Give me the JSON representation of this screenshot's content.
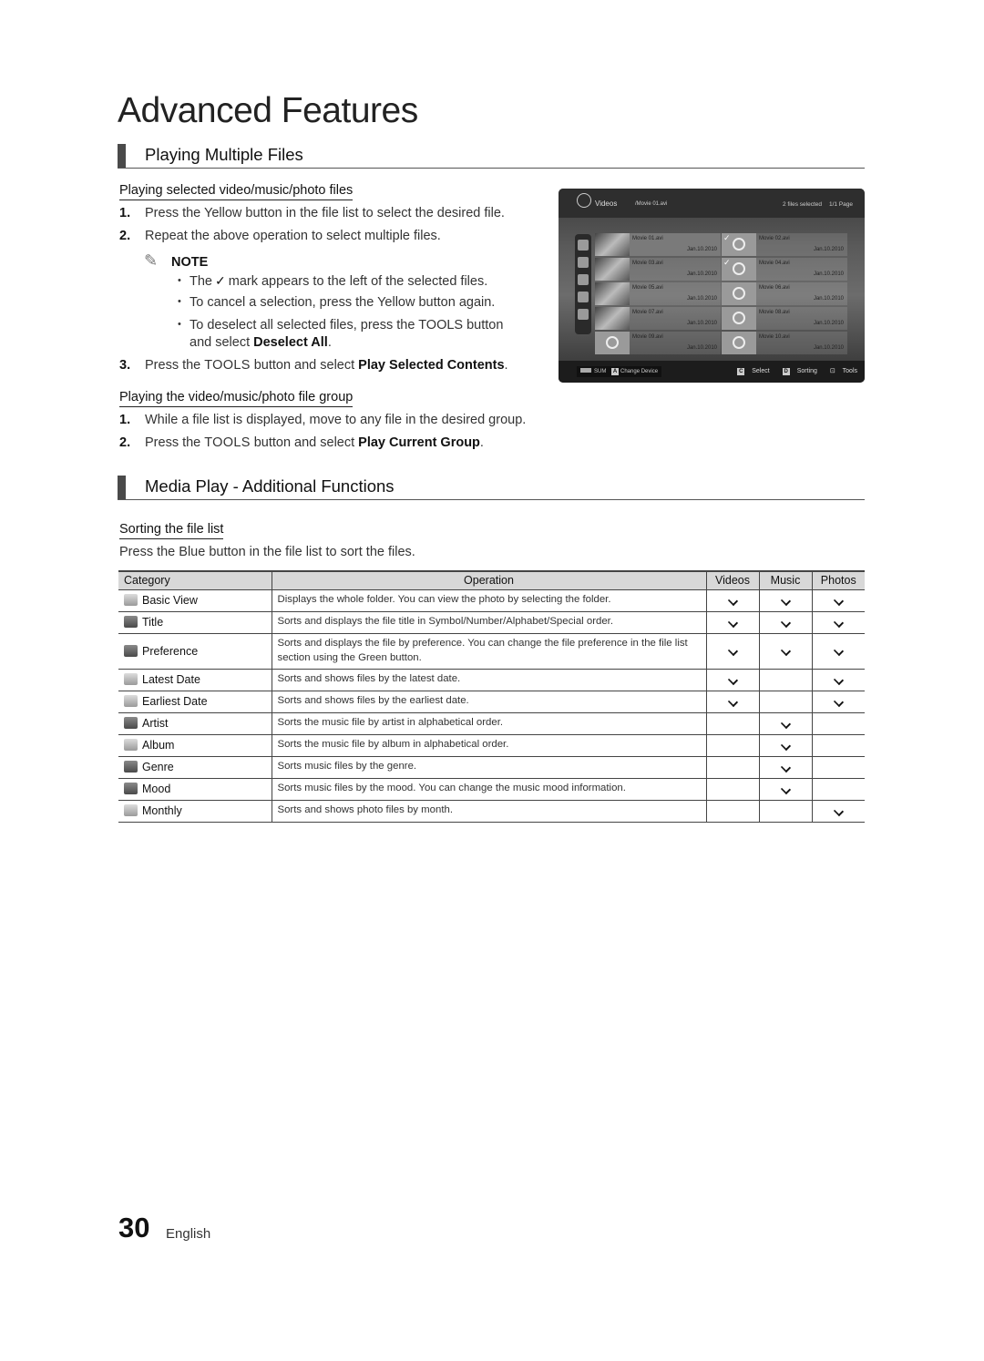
{
  "page": {
    "title": "Advanced Features",
    "page_number": "30",
    "language": "English"
  },
  "section1": {
    "heading": "Playing Multiple Files",
    "sub1": {
      "heading": "Playing selected video/music/photo files",
      "steps": [
        {
          "num": "1.",
          "text": "Press the Yellow button in the file list to select the desired file."
        },
        {
          "num": "2.",
          "text": "Repeat the above operation to select multiple files."
        }
      ],
      "note_label": "NOTE",
      "notes": {
        "n1_pre": "The",
        "n1_post": "mark appears to the left of the selected files.",
        "n2": "To cancel a selection, press the Yellow button again.",
        "n3_pre": "To deselect all selected files, press the ",
        "n3_tools": "TOOLS",
        "n3_post": " button",
        "n3_line2_pre": "and select ",
        "n3_line2_bold": "Deselect All",
        "n3_line2_post": "."
      },
      "step3": {
        "num": "3.",
        "pre": "Press the ",
        "tools": "TOOLS",
        "mid": " button and select ",
        "bold": "Play Selected Contents",
        "post": "."
      }
    },
    "sub2": {
      "heading": "Playing the video/music/photo file group",
      "step1": {
        "num": "1.",
        "text": "While a file list is displayed, move to any file in the desired group."
      },
      "step2": {
        "num": "2.",
        "pre": "Press the ",
        "tools": "TOOLS",
        "mid": " button and select ",
        "bold": "Play Current Group",
        "post": "."
      }
    }
  },
  "tv_screen": {
    "category": "Videos",
    "path": "/Movie 01.avi",
    "selection_status": "2 files selected",
    "page_info": "1/1 Page",
    "items": [
      {
        "name": "Movie 01.avi",
        "date": "Jan.10.2010",
        "selected": false,
        "focused": true,
        "thumb": "photo"
      },
      {
        "name": "Movie 02.avi",
        "date": "Jan.10.2010",
        "selected": true,
        "focused": false,
        "thumb": "reel"
      },
      {
        "name": "Movie 03.avi",
        "date": "Jan.10.2010",
        "selected": false,
        "focused": false,
        "thumb": "photo"
      },
      {
        "name": "Movie 04.avi",
        "date": "Jan.10.2010",
        "selected": true,
        "focused": false,
        "thumb": "reel"
      },
      {
        "name": "Movie 05.avi",
        "date": "Jan.10.2010",
        "selected": false,
        "focused": false,
        "thumb": "photo"
      },
      {
        "name": "Movie 06.avi",
        "date": "Jan.10.2010",
        "selected": false,
        "focused": false,
        "thumb": "reel"
      },
      {
        "name": "Movie 07.avi",
        "date": "Jan.10.2010",
        "selected": false,
        "focused": false,
        "thumb": "photo"
      },
      {
        "name": "Movie 08.avi",
        "date": "Jan.10.2010",
        "selected": false,
        "focused": false,
        "thumb": "reel"
      },
      {
        "name": "Movie 09.avi",
        "date": "Jan.10.2010",
        "selected": false,
        "focused": false,
        "thumb": "reel"
      },
      {
        "name": "Movie 10.avi",
        "date": "Jan.10.2010",
        "selected": false,
        "focused": false,
        "thumb": "reel"
      }
    ],
    "sidebar_icons": [
      "folder-icon",
      "title-az-icon",
      "latest-date-icon",
      "earliest-date-icon",
      "preference-star-icon"
    ],
    "bottom_left": {
      "sum_label": "SUM",
      "key_a": "A",
      "change_device": "Change Device"
    },
    "bottom_right": {
      "key_c": "C",
      "select": "Select",
      "key_d": "D",
      "sorting": "Sorting",
      "tools": "Tools"
    }
  },
  "section2": {
    "heading": "Media Play - Additional Functions",
    "sub1": {
      "heading": "Sorting the file list",
      "intro": "Press the Blue button in the file list to sort the files."
    },
    "table": {
      "headers": {
        "category": "Category",
        "operation": "Operation",
        "videos": "Videos",
        "music": "Music",
        "photos": "Photos"
      },
      "rows": [
        {
          "category": "Basic View",
          "icon": "folder-icon",
          "operation": "Displays the whole folder. You can view the photo by selecting the folder.",
          "videos": true,
          "music": true,
          "photos": true
        },
        {
          "category": "Title",
          "icon": "title-az-icon",
          "operation": "Sorts and displays the file title in Symbol/Number/Alphabet/Special order.",
          "videos": true,
          "music": true,
          "photos": true
        },
        {
          "category": "Preference",
          "icon": "preference-star-icon",
          "operation": "Sorts and displays the file by preference. You can change the file preference in the file list section using the Green button.",
          "videos": true,
          "music": true,
          "photos": true
        },
        {
          "category": "Latest Date",
          "icon": "latest-date-icon",
          "operation": "Sorts and shows files by the latest date.",
          "videos": true,
          "music": false,
          "photos": true
        },
        {
          "category": "Earliest Date",
          "icon": "earliest-date-icon",
          "operation": "Sorts and shows files by the earliest date.",
          "videos": true,
          "music": false,
          "photos": true
        },
        {
          "category": "Artist",
          "icon": "artist-icon",
          "operation": "Sorts the music file by artist in alphabetical order.",
          "videos": false,
          "music": true,
          "photos": false
        },
        {
          "category": "Album",
          "icon": "album-icon",
          "operation": "Sorts the music file by album in alphabetical order.",
          "videos": false,
          "music": true,
          "photos": false
        },
        {
          "category": "Genre",
          "icon": "genre-icon",
          "operation": "Sorts music files by the genre.",
          "videos": false,
          "music": true,
          "photos": false
        },
        {
          "category": "Mood",
          "icon": "mood-icon",
          "operation": "Sorts music files by the mood. You can change the music mood information.",
          "videos": false,
          "music": true,
          "photos": false
        },
        {
          "category": "Monthly",
          "icon": "monthly-calendar-icon",
          "operation": "Sorts and shows photo files by month.",
          "videos": false,
          "music": false,
          "photos": true
        }
      ]
    }
  }
}
